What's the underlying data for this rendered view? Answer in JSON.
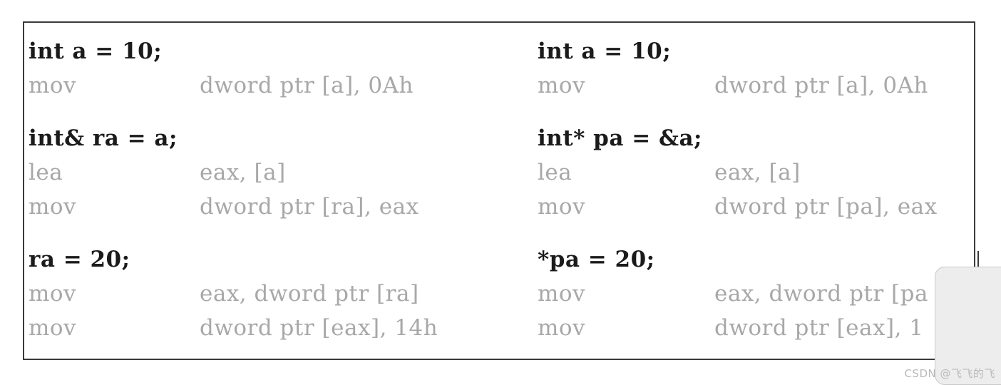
{
  "figure": {
    "border_color": "#3a3a3a",
    "background_color": "#ffffff",
    "source_text_color": "#1b1b1b",
    "asm_text_color": "#a8a8a8"
  },
  "columns": [
    {
      "id": "reference-column",
      "blocks": [
        {
          "source": "int a = 10;",
          "asm": [
            {
              "mnemonic": "mov",
              "operands": "dword ptr [a], 0Ah"
            }
          ]
        },
        {
          "source": "int& ra = a;",
          "asm": [
            {
              "mnemonic": "lea",
              "operands": "eax, [a]"
            },
            {
              "mnemonic": "mov",
              "operands": "dword ptr [ra], eax"
            }
          ]
        },
        {
          "source": "ra = 20;",
          "asm": [
            {
              "mnemonic": "mov",
              "operands": "eax, dword ptr [ra]"
            },
            {
              "mnemonic": "mov",
              "operands": "dword ptr [eax], 14h"
            }
          ]
        }
      ]
    },
    {
      "id": "pointer-column",
      "blocks": [
        {
          "source": "int a = 10;",
          "asm": [
            {
              "mnemonic": "mov",
              "operands": "dword ptr [a], 0Ah"
            }
          ]
        },
        {
          "source": "int* pa = &a;",
          "asm": [
            {
              "mnemonic": "lea",
              "operands": "eax, [a]"
            },
            {
              "mnemonic": "mov",
              "operands": "dword ptr [pa], eax"
            }
          ]
        },
        {
          "source": "*pa = 20;",
          "asm": [
            {
              "mnemonic": "mov",
              "operands": "eax, dword ptr [pa"
            },
            {
              "mnemonic": "mov",
              "operands": "dword ptr [eax], 1"
            }
          ]
        }
      ]
    }
  ],
  "watermark": {
    "text": "CSDN @飞飞的飞"
  }
}
